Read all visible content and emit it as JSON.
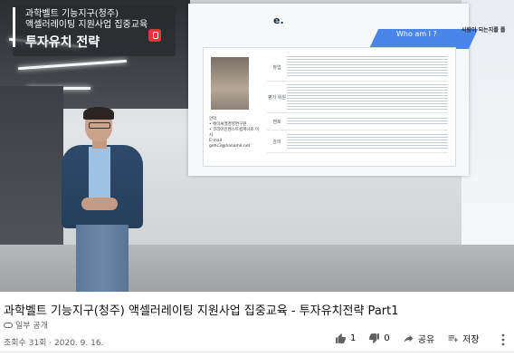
{
  "video": {
    "overlay_subtitle_1": "과학벨트 기능지구(청주)",
    "overlay_subtitle_2": "액셀러레이팅 지원사업 집중교육",
    "overlay_title": "투자유치 전략",
    "slide_tab": "Who am I ?",
    "slide_title": "e.",
    "side_text": "사람이 되는지를 를",
    "slide_labels": [
      "창업",
      "평가 위원",
      "멘토",
      "강의"
    ],
    "slide_name_lines": [
      "안덕",
      "• 에이씨엘경영연구원",
      "• 코리아인벤스트컴퍼니조 이사",
      "E-mail",
      "gehc3@hanamil.net"
    ]
  },
  "info": {
    "title": "과학벨트 기능지구(청주) 액셀러레이팅 지원사업 집중교육 - 투자유치전략 Part1",
    "privacy": "일부 공개",
    "views": "조회수 31회 · 2020. 9. 16.",
    "like_count": "1",
    "dislike_count": "0",
    "share_label": "공유",
    "save_label": "저장"
  },
  "icons": {
    "like": "thumbs-up-icon",
    "dislike": "thumbs-down-icon",
    "share": "share-icon",
    "save": "playlist-add-icon",
    "more": "more-icon",
    "privacy": "link-icon"
  },
  "colors": {
    "accent_blue": "#4a86e8",
    "logo_red": "#e5353b"
  }
}
